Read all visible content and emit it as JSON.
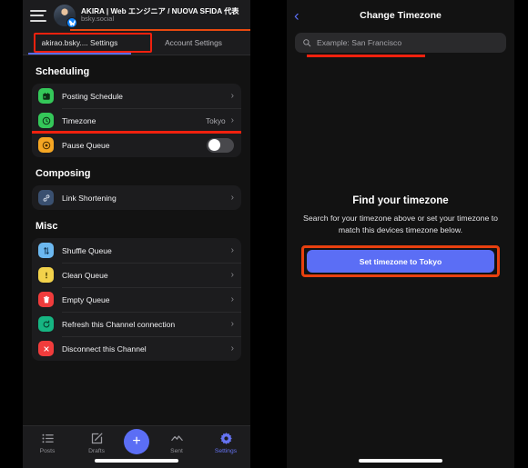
{
  "left": {
    "header": {
      "menu_icon": "hamburger-icon",
      "title": "AKIRA | Web エンジニア / NUOVA SFIDA 代表",
      "subtitle": "bsky.social",
      "badge_icon": "bluesky-butterfly-icon"
    },
    "tabs": [
      {
        "label": "akirao.bsky.... Settings",
        "active": true
      },
      {
        "label": "Account Settings",
        "active": false
      }
    ],
    "sections": [
      {
        "title": "Scheduling",
        "rows": [
          {
            "label": "Posting Schedule",
            "icon": "calendar-icon",
            "icon_color": "#34c759",
            "value": "",
            "control": "chevron"
          },
          {
            "label": "Timezone",
            "icon": "clock-icon",
            "icon_color": "#34c759",
            "value": "Tokyo",
            "control": "chevron"
          },
          {
            "label": "Pause Queue",
            "icon": "pause-circle-icon",
            "icon_color": "#f5a623",
            "value": "",
            "control": "toggle",
            "toggle_on": false
          }
        ]
      },
      {
        "title": "Composing",
        "rows": [
          {
            "label": "Link Shortening",
            "icon": "link-icon",
            "icon_color": "#3a5070",
            "value": "",
            "control": "chevron"
          }
        ]
      },
      {
        "title": "Misc",
        "rows": [
          {
            "label": "Shuffle Queue",
            "icon": "shuffle-icon",
            "icon_color": "#6cb8f0",
            "value": "",
            "control": "chevron"
          },
          {
            "label": "Clean Queue",
            "icon": "warning-icon",
            "icon_color": "#f2d24b",
            "value": "",
            "control": "chevron"
          },
          {
            "label": "Empty Queue",
            "icon": "trash-icon",
            "icon_color": "#f03c3c",
            "value": "",
            "control": "chevron"
          },
          {
            "label": "Refresh this Channel connection",
            "icon": "refresh-icon",
            "icon_color": "#16b582",
            "value": "",
            "control": "chevron"
          },
          {
            "label": "Disconnect this Channel",
            "icon": "close-x-icon",
            "icon_color": "#f03c3c",
            "value": "",
            "control": "chevron"
          }
        ]
      }
    ],
    "bottom_nav": {
      "items": [
        {
          "label": "Posts",
          "icon": "list-icon",
          "active": false
        },
        {
          "label": "Drafts",
          "icon": "compose-icon",
          "active": false
        },
        {
          "label": "Sent",
          "icon": "chart-line-icon",
          "active": false
        },
        {
          "label": "Settings",
          "icon": "gear-icon",
          "active": true
        }
      ],
      "fab_label": "+",
      "fab_icon": "plus-icon"
    }
  },
  "right": {
    "header": {
      "back_icon": "chevron-left-icon",
      "title": "Change Timezone"
    },
    "search": {
      "icon": "search-icon",
      "placeholder": "Example: San Francisco",
      "value": ""
    },
    "empty_state": {
      "title": "Find your timezone",
      "description": "Search for your timezone above or set your timezone to match this devices timezone below.",
      "button_label": "Set timezone to Tokyo"
    }
  },
  "colors": {
    "highlight": "#f0210e",
    "accent": "#5b6ef5",
    "orange_underline": "#e8490f",
    "page_bg": "#000000",
    "phone_bg": "#121212",
    "card_bg": "#1c1c1e"
  }
}
